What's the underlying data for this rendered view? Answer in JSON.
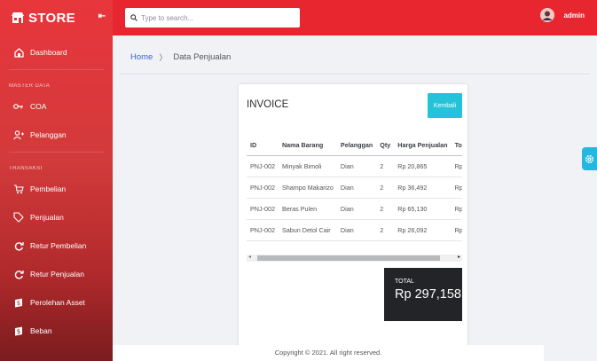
{
  "brand": {
    "name": "STORE",
    "logo_text": "STORE",
    "collapse_icon": "collapse-arrow-icon"
  },
  "header": {
    "search_placeholder": "Type to search...",
    "user_name": "admin"
  },
  "sidebar": {
    "items": [
      {
        "label": "Dashboard",
        "icon": "dashboard-icon"
      },
      {
        "label": "COA",
        "icon": "key-icon"
      },
      {
        "label": "Pelanggan",
        "icon": "user-plus-icon"
      },
      {
        "label": "Pembelian",
        "icon": "cart-icon"
      },
      {
        "label": "Penjualan",
        "icon": "tag-icon"
      },
      {
        "label": "Retur Pembelian",
        "icon": "refresh-icon"
      },
      {
        "label": "Retur Penjualan",
        "icon": "refresh-icon"
      },
      {
        "label": "Perolehan Asset",
        "icon": "dollar-icon"
      },
      {
        "label": "Beban",
        "icon": "dollar-icon"
      }
    ],
    "sections": {
      "master": "MASTER DATA",
      "transaksi": "TRANSAKSI"
    }
  },
  "breadcrumb": {
    "home": "Home",
    "current": "Data Penjualan"
  },
  "invoice": {
    "title": "INVOICE",
    "back_button": "Kembali",
    "columns": [
      "ID",
      "Nama Barang",
      "Pelanggan",
      "Qty",
      "Harga Penjualan",
      "Tot"
    ],
    "rows": [
      [
        "PNJ-002",
        "Minyak Bimoli",
        "Dian",
        "2",
        "Rp 20,865",
        "Rp"
      ],
      [
        "PNJ-002",
        "Shampo Makarizo",
        "Dian",
        "2",
        "Rp 36,492",
        "Rp"
      ],
      [
        "PNJ-002",
        "Beras Pulen",
        "Dian",
        "2",
        "Rp 65,130",
        "Rp"
      ],
      [
        "PNJ-002",
        "Sabun Detol Cair",
        "Dian",
        "2",
        "Rp 26,092",
        "Rp"
      ]
    ],
    "total_label": "TOTAL",
    "total_value": "Rp 297,158"
  },
  "footer": {
    "text": "Copyright © 2021. All right reserved."
  },
  "colors": {
    "header": "#e8262f",
    "accent_button": "#25c3d9",
    "total_box": "#222428",
    "link": "#3d63c9"
  }
}
